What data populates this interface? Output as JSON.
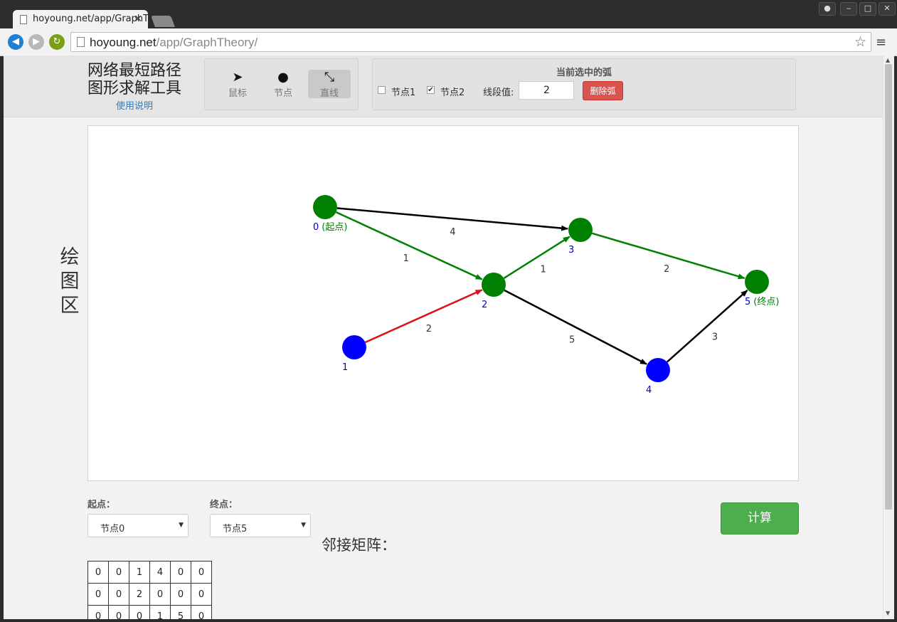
{
  "browser": {
    "tab_title": "hoyoung.net/app/GraphTheory/",
    "url_host": "hoyoung.net",
    "url_path": "/app/GraphTheory/",
    "win_user_icon": "user-icon",
    "win_min": "‒",
    "win_max": "□",
    "win_close": "✕"
  },
  "header": {
    "title_line1": "网络最短路径",
    "title_line2": "图形求解工具",
    "help": "使用说明"
  },
  "tools": {
    "mouse": "鼠标",
    "node": "节点",
    "line": "直线",
    "active": "line"
  },
  "arc_panel": {
    "title": "当前选中的弧",
    "node1_label": "节点1",
    "node1_checked": false,
    "node2_label": "节点2",
    "node2_checked": true,
    "weight_label": "线段值:",
    "weight_value": "2",
    "delete_label": "删除弧"
  },
  "canvas": {
    "side_label": [
      "绘",
      "图",
      "区"
    ]
  },
  "graph": {
    "colors": {
      "green": "#008000",
      "blue": "#0000ff",
      "red": "#dd1111",
      "black": "#000000",
      "label_blue": "#0000cc"
    },
    "nodes": [
      {
        "id": 0,
        "label": "0",
        "tag": "(起点)",
        "color": "green"
      },
      {
        "id": 1,
        "label": "1",
        "tag": "",
        "color": "blue"
      },
      {
        "id": 2,
        "label": "2",
        "tag": "",
        "color": "green"
      },
      {
        "id": 3,
        "label": "3",
        "tag": "",
        "color": "green"
      },
      {
        "id": 4,
        "label": "4",
        "tag": "",
        "color": "blue"
      },
      {
        "id": 5,
        "label": "5",
        "tag": "(终点)",
        "color": "green"
      }
    ],
    "edges": [
      {
        "from": 0,
        "to": 2,
        "weight": "1",
        "color": "green"
      },
      {
        "from": 0,
        "to": 3,
        "weight": "4",
        "color": "black"
      },
      {
        "from": 1,
        "to": 2,
        "weight": "2",
        "color": "red"
      },
      {
        "from": 2,
        "to": 3,
        "weight": "1",
        "color": "green"
      },
      {
        "from": 2,
        "to": 4,
        "weight": "5",
        "color": "black"
      },
      {
        "from": 3,
        "to": 5,
        "weight": "2",
        "color": "green"
      },
      {
        "from": 4,
        "to": 5,
        "weight": "3",
        "color": "black"
      }
    ]
  },
  "controls": {
    "start_label": "起点：",
    "start_value": "节点0",
    "end_label": "终点：",
    "end_value": "节点5",
    "compute_label": "计算"
  },
  "matrix": {
    "title": "邻接矩阵：",
    "rows": [
      [
        "0",
        "0",
        "1",
        "4",
        "0",
        "0"
      ],
      [
        "0",
        "0",
        "2",
        "0",
        "0",
        "0"
      ],
      [
        "0",
        "0",
        "0",
        "1",
        "5",
        "0"
      ]
    ]
  }
}
